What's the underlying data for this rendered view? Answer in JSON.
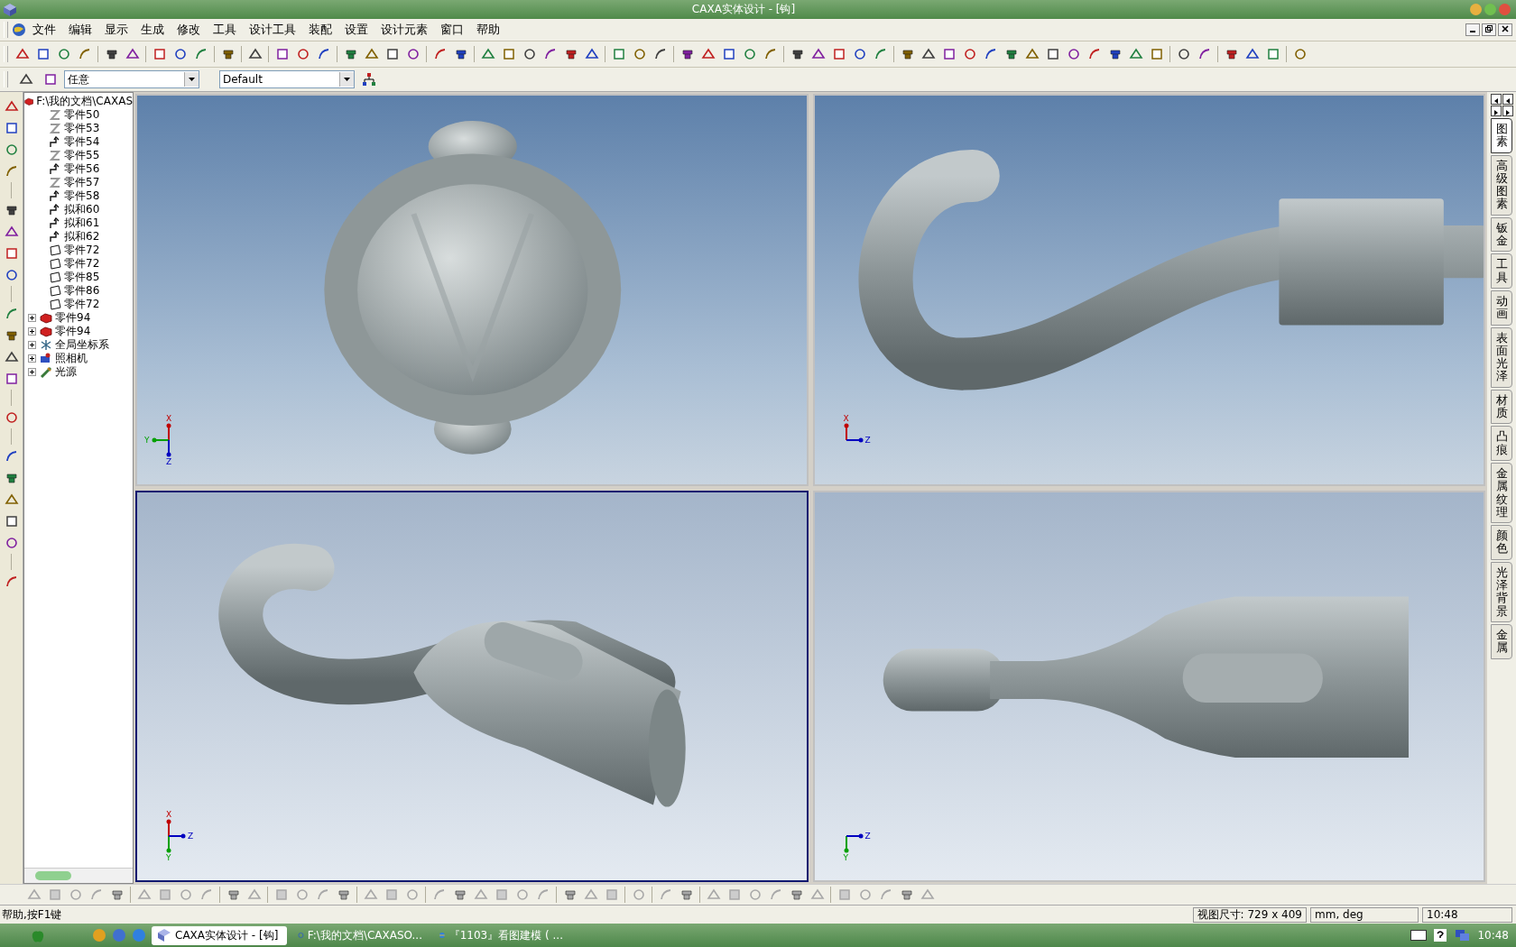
{
  "window": {
    "title": "CAXA实体设计 - [钩]"
  },
  "menu": [
    "文件",
    "编辑",
    "显示",
    "生成",
    "修改",
    "工具",
    "设计工具",
    "装配",
    "设置",
    "设计元素",
    "窗口",
    "帮助"
  ],
  "selector_bar": {
    "filter": "任意",
    "style": "Default"
  },
  "tree": {
    "root": "F:\\我的文档\\CAXAS",
    "items": [
      {
        "label": "零件50",
        "kind": "sketch",
        "expandable": false
      },
      {
        "label": "零件53",
        "kind": "sketch",
        "expandable": false
      },
      {
        "label": "零件54",
        "kind": "curve",
        "expandable": false
      },
      {
        "label": "零件55",
        "kind": "sketch",
        "expandable": false
      },
      {
        "label": "零件56",
        "kind": "curve",
        "expandable": false
      },
      {
        "label": "零件57",
        "kind": "sketch",
        "expandable": false
      },
      {
        "label": "零件58",
        "kind": "curve",
        "expandable": false
      },
      {
        "label": "拟和60",
        "kind": "curve",
        "expandable": false
      },
      {
        "label": "拟和61",
        "kind": "curve",
        "expandable": false
      },
      {
        "label": "拟和62",
        "kind": "curve",
        "expandable": false
      },
      {
        "label": "零件72",
        "kind": "surface",
        "expandable": false
      },
      {
        "label": "零件72",
        "kind": "surface",
        "expandable": false
      },
      {
        "label": "零件85",
        "kind": "surface",
        "expandable": false
      },
      {
        "label": "零件86",
        "kind": "surface",
        "expandable": false
      },
      {
        "label": "零件72",
        "kind": "surface",
        "expandable": false
      },
      {
        "label": "零件94",
        "kind": "part",
        "expandable": true
      },
      {
        "label": "零件94",
        "kind": "part",
        "expandable": true
      },
      {
        "label": "全局坐标系",
        "kind": "coords",
        "expandable": true
      },
      {
        "label": "照相机",
        "kind": "camera",
        "expandable": true
      },
      {
        "label": "光源",
        "kind": "light",
        "expandable": true
      }
    ]
  },
  "viewports": [
    {
      "kind": "top",
      "selected": false,
      "axes": [
        {
          "label": "X",
          "kind": "up",
          "color": "#c00000"
        },
        {
          "label": "Y",
          "kind": "left",
          "color": "#00a000"
        },
        {
          "label": "Z",
          "kind": "down",
          "color": "#0000c0"
        }
      ]
    },
    {
      "kind": "side",
      "selected": false,
      "axes": [
        {
          "label": "X",
          "kind": "up",
          "color": "#c00000"
        },
        {
          "label": "Z",
          "kind": "right",
          "color": "#0000c0"
        }
      ]
    },
    {
      "kind": "iso",
      "selected": true,
      "axes": [
        {
          "label": "X",
          "kind": "up",
          "color": "#c00000"
        },
        {
          "label": "Y",
          "kind": "down",
          "color": "#00a000"
        },
        {
          "label": "Z",
          "kind": "right",
          "color": "#0000c0"
        }
      ]
    },
    {
      "kind": "front",
      "selected": false,
      "axes": [
        {
          "label": "Y",
          "kind": "down",
          "color": "#00a000"
        },
        {
          "label": "Z",
          "kind": "right",
          "color": "#0000c0"
        }
      ]
    }
  ],
  "design_tabs": [
    {
      "label": "图素",
      "selected": true
    },
    {
      "label": "高级图素",
      "selected": false
    },
    {
      "label": "钣金",
      "selected": false
    },
    {
      "label": "工具",
      "selected": false
    },
    {
      "label": "动画",
      "selected": false
    },
    {
      "label": "表面光泽",
      "selected": false
    },
    {
      "label": "材质",
      "selected": false
    },
    {
      "label": "凸痕",
      "selected": false
    },
    {
      "label": "金属纹理",
      "selected": false
    },
    {
      "label": "颜色",
      "selected": false
    },
    {
      "label": "光泽背景",
      "selected": false
    },
    {
      "label": "金属",
      "selected": false
    }
  ],
  "status_bar": {
    "help": "帮助,按F1键",
    "view_size": "视图尺寸: 729 x 409",
    "units": "mm, deg",
    "time": "10:48"
  },
  "taskbar": {
    "tasks": [
      {
        "label": "CAXA实体设计 - [钩]",
        "selected": true,
        "kind": "app"
      },
      {
        "label": "F:\\我的文档\\CAXASO...",
        "selected": false,
        "kind": "folder"
      },
      {
        "label": "『1103』看图建模 ( ...",
        "selected": false,
        "kind": "browser"
      }
    ],
    "clock": "10:48"
  }
}
